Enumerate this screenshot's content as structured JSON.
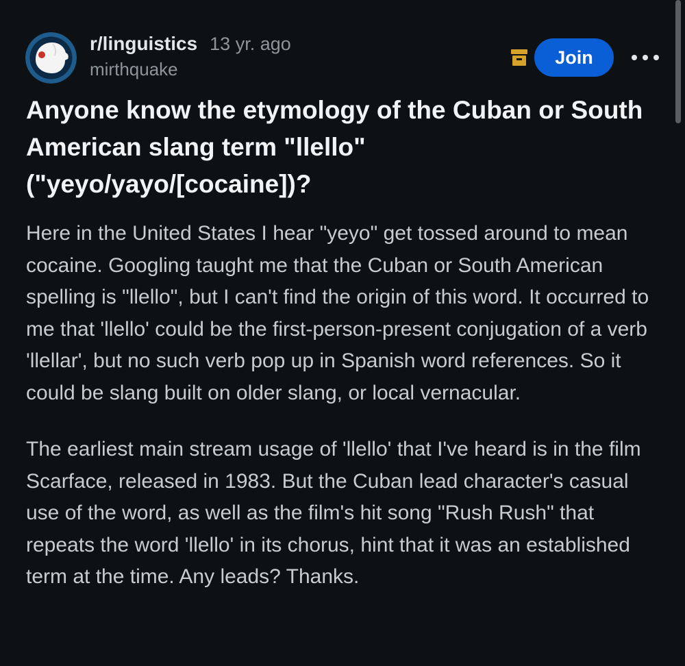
{
  "post": {
    "subreddit": "r/linguistics",
    "timestamp": "13 yr. ago",
    "author": "mirthquake",
    "join_label": "Join",
    "title": "Anyone know the etymology of the Cuban or South American slang term \"llello\" (\"yeyo/yayo/[cocaine])?",
    "body": [
      "Here in the United States I hear \"yeyo\" get tossed around to mean cocaine. Googling taught me that the Cuban or South American spelling is \"llello\", but I can't find the origin of this word. It occurred to me that 'llello' could be the first-person-present conjugation of a verb 'llellar', but no such verb pop up in Spanish word references. So it could be slang built on older slang, or local vernacular.",
      "The earliest main stream usage of 'llello' that I've heard is in the film Scarface, released in 1983. But the Cuban lead character's casual use of the word, as well as the film's hit song \"Rush Rush\" that repeats the word 'llello' in its chorus, hint that it was an established term at the time. Any leads? Thanks."
    ]
  },
  "icons": {
    "avatar": "subreddit-avatar-icon",
    "archive": "archive-icon",
    "more": "more-options-icon"
  },
  "colors": {
    "background": "#0e1113",
    "join_button": "#0b5fd6",
    "archive_icon": "#d6a22a",
    "muted_text": "#8d959c",
    "title_text": "#f2f3f5",
    "body_text": "#c7ccd1"
  }
}
